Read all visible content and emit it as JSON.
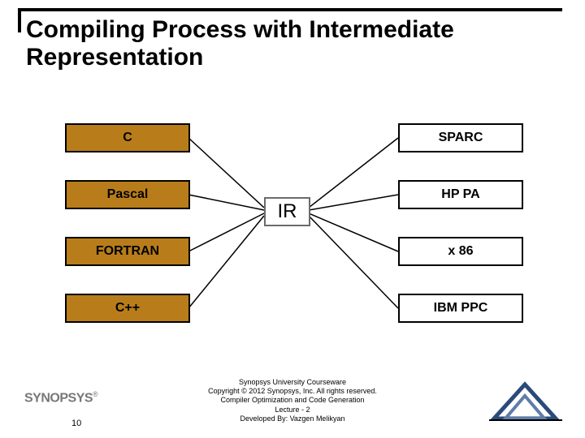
{
  "slide": {
    "title": "Compiling Process with Intermediate Representation",
    "page_number": "10"
  },
  "diagram": {
    "center_label": "IR",
    "sources": [
      "C",
      "Pascal",
      "FORTRAN",
      "C++"
    ],
    "targets": [
      "SPARC",
      "HP PA",
      "x 86",
      "IBM PPC"
    ]
  },
  "footer": {
    "line1": "Synopsys University Courseware",
    "line2": "Copyright © 2012 Synopsys, Inc. All rights reserved.",
    "line3": "Compiler Optimization and Code Generation",
    "line4": "Lecture - 2",
    "line5": "Developed By: Vazgen Melikyan"
  },
  "branding": {
    "company": "SYNOPSYS"
  },
  "colors": {
    "source_fill": "#b87d1a",
    "ir_border": "#6b6b6b"
  }
}
